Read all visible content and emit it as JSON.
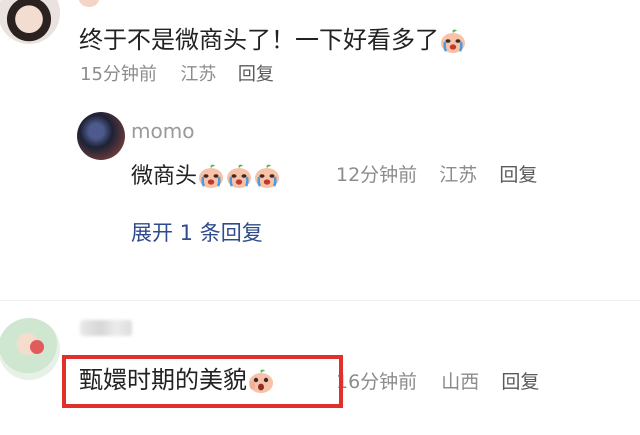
{
  "comment1": {
    "text": "终于不是微商头了！一下好看多了",
    "emoji": "crying-peach-emoji",
    "time": "15分钟前",
    "location": "江苏",
    "reply_label": "回复"
  },
  "reply1": {
    "username": "momo",
    "text": "微商头",
    "emoji_count": 3,
    "emoji": "crying-peach-emoji",
    "time": "12分钟前",
    "location": "江苏",
    "reply_label": "回复",
    "expand_label": "展开 1 条回复"
  },
  "comment2": {
    "text": "甄嬛时期的美貌",
    "emoji": "shocked-peach-emoji",
    "time": "16分钟前",
    "location": "山西",
    "reply_label": "回复"
  },
  "colors": {
    "highlight": "#e0302b",
    "link": "#2f4b8c",
    "text": "#222222",
    "meta": "#8c8c8c"
  }
}
